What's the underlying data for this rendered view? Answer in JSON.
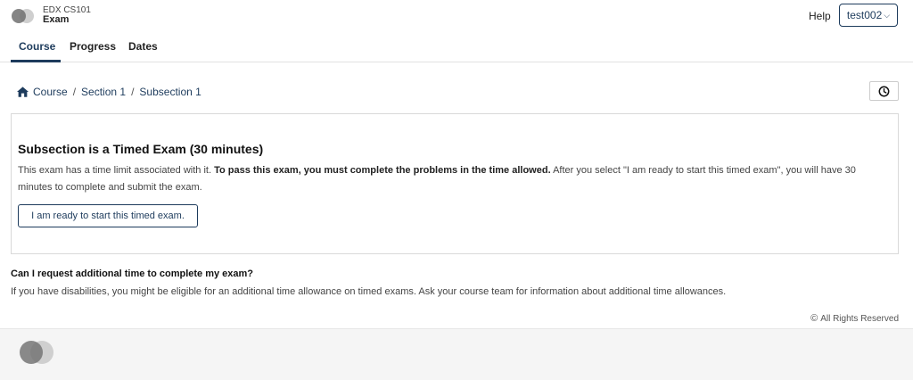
{
  "header": {
    "course_org": "EDX CS101",
    "course_title": "Exam",
    "help_label": "Help",
    "user_label": "test002"
  },
  "tabs": [
    {
      "label": "Course",
      "active": true
    },
    {
      "label": "Progress",
      "active": false
    },
    {
      "label": "Dates",
      "active": false
    }
  ],
  "breadcrumb": {
    "items": [
      "Course",
      "Section 1",
      "Subsection 1"
    ],
    "separator": "/"
  },
  "exam": {
    "title": "Subsection is a Timed Exam (30 minutes)",
    "desc_intro": "This exam has a time limit associated with it. ",
    "desc_bold": "To pass this exam, you must complete the problems in the time allowed.",
    "desc_rest": " After you select \"I am ready to start this timed exam\", you will have 30 minutes to complete and submit the exam.",
    "start_button": "I am ready to start this timed exam."
  },
  "faq": {
    "question": "Can I request additional time to complete my exam?",
    "answer": "If you have disabilities, you might be eligible for an additional time allowance on timed exams. Ask your course team for information about additional time allowances."
  },
  "footer": {
    "copyright_symbol": "©",
    "rights": "All Rights Reserved"
  },
  "colors": {
    "accent": "#1d3b5c",
    "border": "#d9d9d9",
    "footer_bg": "#f5f5f5"
  },
  "icons": {
    "logo": "edx-logo-icon",
    "home": "home-icon",
    "clock": "clock-icon",
    "chevron": "chevron-down-icon"
  }
}
